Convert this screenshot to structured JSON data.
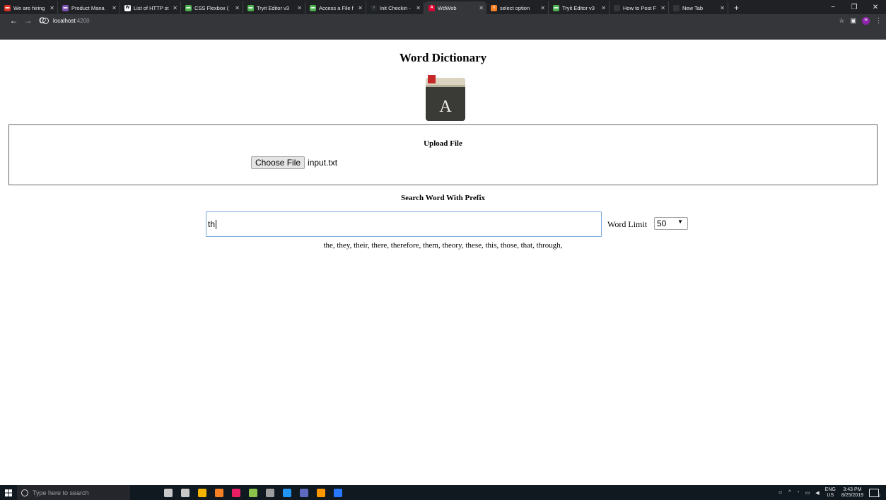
{
  "browser": {
    "tabs": [
      {
        "label": "We are hiring",
        "color": "#d93025",
        "glyph": "▬"
      },
      {
        "label": "Product Mana",
        "color": "#7a4fb0",
        "glyph": "▬"
      },
      {
        "label": "List of HTTP st",
        "color": "#ffffff",
        "glyph": "W"
      },
      {
        "label": "CSS Flexbox (",
        "color": "#4caf50",
        "glyph": "▬"
      },
      {
        "label": "Tryit Editor v3",
        "color": "#4caf50",
        "glyph": "▬"
      },
      {
        "label": "Access a File f",
        "color": "#4caf50",
        "glyph": "▬"
      },
      {
        "label": "Init Checkin -",
        "color": "#24292e",
        "glyph": "○"
      },
      {
        "label": "WdWeb",
        "color": "#dd0031",
        "glyph": "A"
      },
      {
        "label": "select option",
        "color": "#f48024",
        "glyph": "≡"
      },
      {
        "label": "Tryit Editor v3",
        "color": "#4caf50",
        "glyph": "▬"
      },
      {
        "label": "How to Post F",
        "color": "#35363a",
        "glyph": ""
      },
      {
        "label": "New Tab",
        "color": "#35363a",
        "glyph": ""
      }
    ],
    "active_tab_index": 7,
    "new_tab": "+",
    "window_controls": {
      "minimize": "−",
      "maximize": "❐",
      "close": "✕"
    },
    "nav": {
      "back": "←",
      "forward": "→",
      "reload": "C"
    },
    "url": {
      "info": "i",
      "host": "localhost",
      "port": ":4200"
    },
    "toolbar_right": {
      "star": "☆",
      "ext": "▣",
      "profile": "H",
      "menu": "⋮"
    }
  },
  "page": {
    "title": "Word Dictionary",
    "logo_letter": "A",
    "upload": {
      "heading": "Upload File",
      "button_label": "Choose File",
      "file_name": "input.txt"
    },
    "search": {
      "heading": "Search Word With Prefix",
      "value": "th",
      "limit_label": "Word Limit",
      "limit_value": "50",
      "results": "the, they, their, there, therefore, them, theory, these, this, those, that, through,"
    }
  },
  "taskbar": {
    "search_placeholder": "Type here to search",
    "icon_colors": [
      "#c8c8c8",
      "#c8c8c8",
      "#f4b400",
      "#f48024",
      "#e91e63",
      "#8bc34a",
      "#9e9e9e",
      "#2196f3",
      "#5c6bc0",
      "#ff9800",
      "#2979ff"
    ],
    "tray": {
      "lang_top": "ENG",
      "lang_bottom": "US",
      "time": "3:43 PM",
      "date": "8/25/2019",
      "notif_count": "2"
    }
  },
  "colors": {
    "tabbar_bg": "#202124",
    "toolbar_bg": "#35363a",
    "input_focus_border": "#7aa7dc",
    "taskbar_bg": "#101820"
  }
}
